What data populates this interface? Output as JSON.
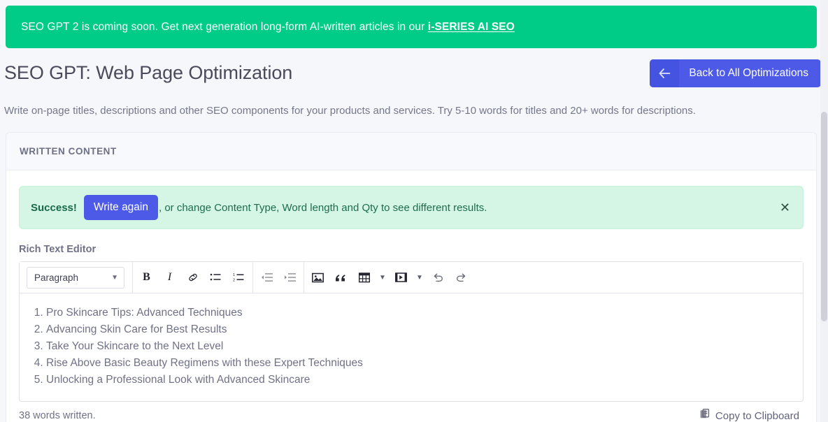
{
  "banner": {
    "text": "SEO GPT 2 is coming soon. Get next generation long-form AI-written articles in our ",
    "link_label": "i-SERIES AI SEO",
    "bg_color": "#00cc88"
  },
  "header": {
    "title": "SEO GPT: Web Page Optimization",
    "back_button": {
      "label": "Back to All Optimizations",
      "icon": "arrow-left-icon",
      "color": "#4d5ae8"
    },
    "description": "Write on-page titles, descriptions and other SEO components for your products and services. Try 5-10 words for titles and 20+ words for descriptions."
  },
  "card": {
    "header_title": "WRITTEN CONTENT"
  },
  "alert": {
    "strong_label": "Success!",
    "button_label": "Write again",
    "rest_text": ", or change Content Type, Word length and Qty to see different results.",
    "close_icon": "close-icon",
    "bg_color": "#d5f6e5",
    "text_color": "#1d6c4f"
  },
  "editor": {
    "label": "Rich Text Editor",
    "toolbar": {
      "format_select_value": "Paragraph",
      "buttons": [
        {
          "name": "bold-icon",
          "label": "B"
        },
        {
          "name": "italic-icon",
          "label": "I"
        },
        {
          "name": "link-icon",
          "label": "link"
        },
        {
          "name": "bulleted-list-icon",
          "label": "bulleted list"
        },
        {
          "name": "numbered-list-icon",
          "label": "numbered list"
        },
        {
          "name": "outdent-icon",
          "label": "outdent"
        },
        {
          "name": "indent-icon",
          "label": "indent"
        },
        {
          "name": "image-icon",
          "label": "image"
        },
        {
          "name": "blockquote-icon",
          "label": "blockquote"
        },
        {
          "name": "table-icon",
          "label": "table"
        },
        {
          "name": "media-icon",
          "label": "media"
        },
        {
          "name": "undo-icon",
          "label": "undo"
        },
        {
          "name": "redo-icon",
          "label": "redo"
        }
      ]
    },
    "content_items": [
      "Pro Skincare Tips: Advanced Techniques",
      "Advancing Skin Care for Best Results",
      "Take Your Skincare to the Next Level",
      "Rise Above Basic Beauty Regimens with these Expert Techniques",
      "Unlocking a Professional Look with Advanced Skincare"
    ],
    "word_count": "38 words written.",
    "copy_button_label": "Copy to Clipboard",
    "copy_button_icon": "clipboard-icon"
  }
}
